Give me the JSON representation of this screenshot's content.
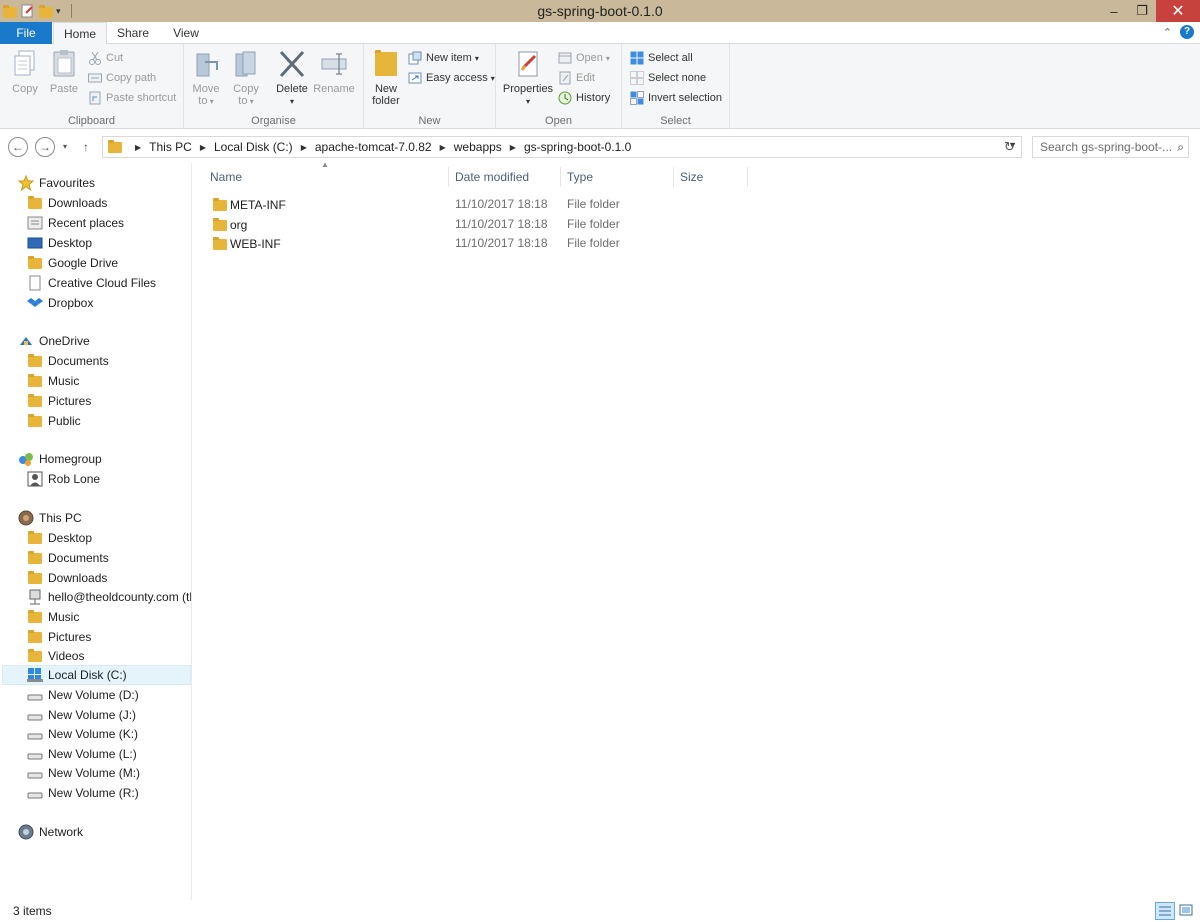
{
  "window": {
    "title": "gs-spring-boot-0.1.0",
    "controls": {
      "minimize": "–",
      "maximize": "❐",
      "close": "✕"
    }
  },
  "ribbon_tabs": [
    "File",
    "Home",
    "Share",
    "View"
  ],
  "ribbon": {
    "clipboard": {
      "label": "Clipboard",
      "copy": "Copy",
      "paste": "Paste",
      "cut": "Cut",
      "copy_path": "Copy path",
      "paste_shortcut": "Paste shortcut"
    },
    "organise": {
      "label": "Organise",
      "move_to": [
        "Move",
        "to"
      ],
      "copy_to": [
        "Copy",
        "to"
      ],
      "delete": "Delete",
      "rename": "Rename"
    },
    "new": {
      "label": "New",
      "new_folder": [
        "New",
        "folder"
      ],
      "new_item": "New item",
      "easy_access": "Easy access"
    },
    "open": {
      "label": "Open",
      "properties": "Properties",
      "open": "Open",
      "edit": "Edit",
      "history": "History"
    },
    "select": {
      "label": "Select",
      "select_all": "Select all",
      "select_none": "Select none",
      "invert_selection": "Invert selection"
    }
  },
  "address": {
    "breadcrumbs": [
      "This PC",
      "Local Disk (C:)",
      "apache-tomcat-7.0.82",
      "webapps",
      "gs-spring-boot-0.1.0"
    ],
    "search_placeholder": "Search gs-spring-boot-..."
  },
  "nav": {
    "favourites": "Favourites",
    "favourites_items": [
      "Downloads",
      "Recent places",
      "Desktop",
      "Google Drive",
      "Creative Cloud Files",
      "Dropbox"
    ],
    "onedrive": "OneDrive",
    "onedrive_items": [
      "Documents",
      "Music",
      "Pictures",
      "Public"
    ],
    "homegroup": "Homegroup",
    "homegroup_items": [
      "Rob Lone"
    ],
    "this_pc": "This PC",
    "this_pc_items": [
      "Desktop",
      "Documents",
      "Downloads",
      "hello@theoldcounty.com (th",
      "Music",
      "Pictures",
      "Videos",
      "Local Disk (C:)",
      "New Volume (D:)",
      "New Volume (J:)",
      "New Volume (K:)",
      "New Volume (L:)",
      "New Volume (M:)",
      "New Volume (R:)"
    ],
    "network": "Network",
    "selected": "Local Disk (C:)"
  },
  "columns": [
    "Name",
    "Date modified",
    "Type",
    "Size"
  ],
  "files": [
    {
      "name": "META-INF",
      "date": "11/10/2017 18:18",
      "type": "File folder"
    },
    {
      "name": "org",
      "date": "11/10/2017 18:18",
      "type": "File folder"
    },
    {
      "name": "WEB-INF",
      "date": "11/10/2017 18:18",
      "type": "File folder"
    }
  ],
  "status": {
    "count": "3 items"
  },
  "colors": {
    "file_tab": "#1979ca",
    "titlebar": "#c9b99a",
    "close": "#c7423c",
    "folder": "#e8b53b"
  }
}
